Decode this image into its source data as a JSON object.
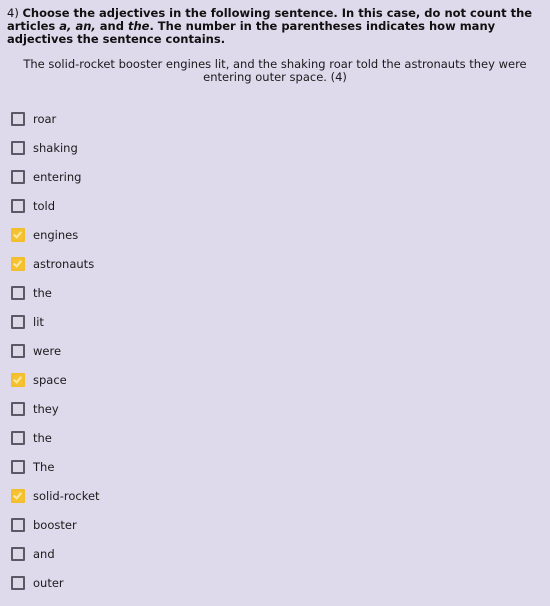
{
  "question": {
    "number": "4)",
    "part1": "Choose the adjectives in the following sentence.  In this case, do not count the articles ",
    "article_a": "a,",
    "article_an": "an,",
    "and": " and ",
    "article_the": "the",
    "part2": ".  The number in the parentheses indicates how many adjectives the sentence contains."
  },
  "sentence": "The solid-rocket booster engines lit, and the shaking roar told the astronauts they were entering outer space. (4)",
  "colors": {
    "background": "#dedaec",
    "checked": "#f5c232",
    "unchecked_border": "#5c5868"
  },
  "options": [
    {
      "label": "roar",
      "checked": false
    },
    {
      "label": "shaking",
      "checked": false
    },
    {
      "label": "entering",
      "checked": false
    },
    {
      "label": "told",
      "checked": false
    },
    {
      "label": "engines",
      "checked": true
    },
    {
      "label": "astronauts",
      "checked": true
    },
    {
      "label": "the",
      "checked": false
    },
    {
      "label": "lit",
      "checked": false
    },
    {
      "label": "were",
      "checked": false
    },
    {
      "label": "space",
      "checked": true
    },
    {
      "label": "they",
      "checked": false
    },
    {
      "label": "the",
      "checked": false
    },
    {
      "label": "The",
      "checked": false
    },
    {
      "label": "solid-rocket",
      "checked": true
    },
    {
      "label": "booster",
      "checked": false
    },
    {
      "label": "and",
      "checked": false
    },
    {
      "label": "outer",
      "checked": false
    }
  ]
}
